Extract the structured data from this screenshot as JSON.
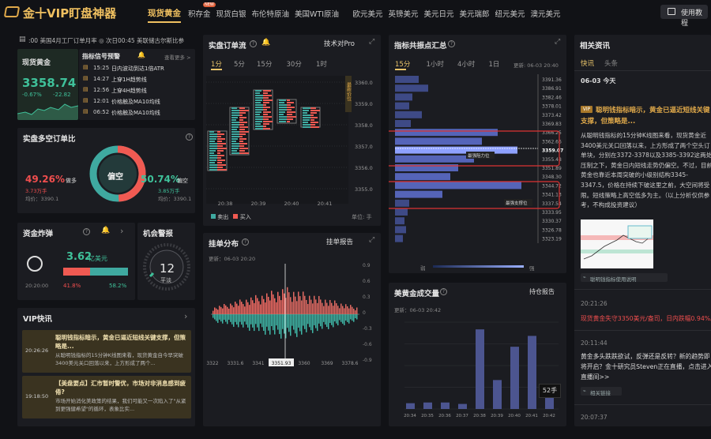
{
  "app": {
    "title": "金十VIP盯盘神器",
    "tutorial": "使用教程"
  },
  "nav": {
    "tabs": [
      "现货黄金",
      "积存金",
      "现货白银",
      "布伦特原油",
      "美国WTI原油",
      "欧元美元",
      "英镑美元",
      "美元日元",
      "美元瑞郎",
      "纽元美元",
      "澳元美元"
    ],
    "new_badge": "NEW"
  },
  "ticker": {
    "text": ":00 美国4月工厂订单月率 ◎ 次日00:45 美联储古尔斯比参"
  },
  "gold_quote": {
    "label": "现货黄金",
    "price": "3358.74",
    "change_pct": "-0.67%",
    "change": "-22.82"
  },
  "signals": {
    "title": "指标信号预警",
    "more": "查看更多 >",
    "items": [
      {
        "time": "15:25",
        "text": "日内波动到达1倍ATR"
      },
      {
        "time": "14:27",
        "text": "上穿1H趋势线"
      },
      {
        "time": "12:56",
        "text": "上穿4H趋势线"
      },
      {
        "time": "12:01",
        "text": "价格触及MA10均线"
      },
      {
        "time": "06:52",
        "text": "价格触及MA10均线"
      }
    ]
  },
  "order_flow": {
    "title": "实盘订单流",
    "tech_label": "技术对Pro",
    "tabs": [
      "1分",
      "5分",
      "15分",
      "30分",
      "1时"
    ],
    "y_ticks": [
      "3360.0",
      "3359.0",
      "3358.0",
      "3357.0",
      "3356.0",
      "3355.0"
    ],
    "x_ticks": [
      "20:38",
      "20:39",
      "20:40",
      "20:41"
    ],
    "legend_sell": "卖出",
    "legend_buy": "买入",
    "unit": "单位: 手",
    "side_tag": "最新价位"
  },
  "pivot": {
    "title": "指标共振点汇总",
    "tabs": [
      "15分",
      "1小时",
      "4小时",
      "1日"
    ],
    "update": "更新: 06-03 20:40",
    "prices": [
      "3391.36",
      "3386.91",
      "3382.46",
      "3378.01",
      "3373.42",
      "3369.83",
      "3366.25",
      "3362.66",
      "3359.07",
      "3355.48",
      "3351.89",
      "3348.30",
      "3344.72",
      "3341.13",
      "3337.54",
      "3333.95",
      "3330.37",
      "3326.78",
      "3323.19"
    ],
    "current": "3359.07",
    "resist_tag": "最强阻力位",
    "support_tag": "最强支撑位",
    "weak": "弱",
    "strong": "强"
  },
  "news": {
    "title": "相关资讯",
    "tabs": [
      "快讯",
      "头条"
    ],
    "date": "06-03 今天",
    "vip": "VIP",
    "headline": "聪明钱指标暗示，黄金已逼近短线关键支撑，但策略是...",
    "body": "从聪明钱指标的15分钟K线图来看，现货黄金近3400美元关口回落以来，上方形成了两个空头订单块，分别在3372-3378以及3385-3392这两处压制之下，黄金日内短线走势仍偏空。不过，目前黄金也靠近本周突破的小级别结构3345-3347.5，价格在持续下破这里之前，大空间将受限。短线策略上高空低多为主。（以上分析仅供参考，不构成投资建议）",
    "tag1": "聪明钱指标使用说明",
    "t2": "20:21:26",
    "n2": "现货黄金失守3350美元/盎司，日内跌幅0.94%。",
    "t3": "20:11:44",
    "n3": "黄金多头跌跌欲试，反弹还是反转？新的趋势即将开启？金十研究员Steven正在直播，点击进入直播间>>",
    "tag2": "相关链接",
    "t4": "20:07:37"
  },
  "long_short": {
    "title": "实盘多空订单比",
    "long_pct": "49.26%",
    "long_label": "做多",
    "long_vol": "3.73万手",
    "long_avg": "均价：3390.1",
    "short_pct": "50.74%",
    "short_label": "偏空",
    "short_vol": "3.85万手",
    "short_avg": "均价：3390.1",
    "center": "偏空",
    "long_ratio": 0.4926
  },
  "order_dist": {
    "title": "挂单分布",
    "report": "挂单报告",
    "update": "更新：06-03 20:20",
    "x_ticks": [
      "3322",
      "3331.6",
      "3341",
      "3351.93",
      "3360",
      "3369",
      "3378.6"
    ],
    "y_ticks": [
      "0.9",
      "0.6",
      "0.3",
      "0",
      "-0.3",
      "-0.6",
      "-0.9"
    ]
  },
  "fund": {
    "title": "资金炸弹",
    "amount": "3.62",
    "unit": "亿美元",
    "time": "20:20:00",
    "sell_pct": "41.8%",
    "buy_pct": "58.2%",
    "buy_ratio": 0.582
  },
  "opportunity": {
    "title": "机会警报",
    "value": "12",
    "label": "平淡"
  },
  "volume": {
    "title": "美黄金成交量",
    "report": "持仓报告",
    "update": "更新：06-03 20:42",
    "unit_label": "52手",
    "x_ticks": [
      "20:34",
      "20:35",
      "20:36",
      "20:37",
      "20:38",
      "20:39",
      "20:40",
      "20:41",
      "20:42"
    ],
    "values": [
      8,
      9,
      9,
      7,
      110,
      40,
      86,
      101,
      34
    ],
    "ymax": 120
  },
  "vip_news": {
    "title": "VIP快讯",
    "items": [
      {
        "time": "20:26:26",
        "title": "聪明钱指标暗示，黄金已逼近短线关键支撑，但策略是...",
        "body": "从聪明钱指标的15分钟K线图来看，现货黄金自今早突破3400美元关口回落以来，上方形成了两个..."
      },
      {
        "time": "19:18:50",
        "title": "【美盘要点】汇市暂时警优，市场对非消息感到疲倦?",
        "body": "市场开始消化美政策的结果，我们可能又一次陷入了\"从紧到更强健希望\"的循环，表象比实..."
      }
    ]
  }
}
